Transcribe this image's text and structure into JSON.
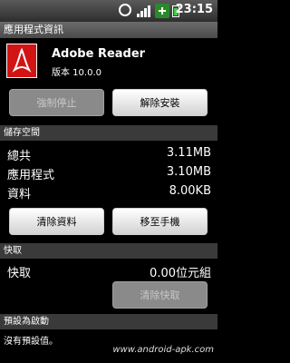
{
  "status_bar": {
    "icons": [
      "alarm-icon",
      "signal-icon",
      "usb-icon",
      "battery-icon"
    ],
    "time": "23:15"
  },
  "title_bar": {
    "title": "應用程式資訊"
  },
  "app": {
    "name": "Adobe Reader",
    "version": "版本 10.0.0",
    "icon": "adobe-reader-icon",
    "icon_color": "#D21414"
  },
  "actions": {
    "force_stop_label": "強制停止",
    "uninstall_label": "解除安裝"
  },
  "storage": {
    "section_title": "儲存空間",
    "rows": [
      {
        "label": "總共",
        "value": "3.11MB"
      },
      {
        "label": "應用程式",
        "value": "3.10MB"
      },
      {
        "label": "資料",
        "value": "8.00KB"
      }
    ],
    "clear_data_label": "清除資料",
    "move_to_phone_label": "移至手機"
  },
  "cache": {
    "section_title": "快取",
    "label": "快取",
    "value": "0.00位元組",
    "clear_cache_label": "清除快取"
  },
  "launch_default": {
    "section_title": "預設為啟動",
    "text": "沒有預設值。"
  },
  "watermark": "www.android-apk.com"
}
